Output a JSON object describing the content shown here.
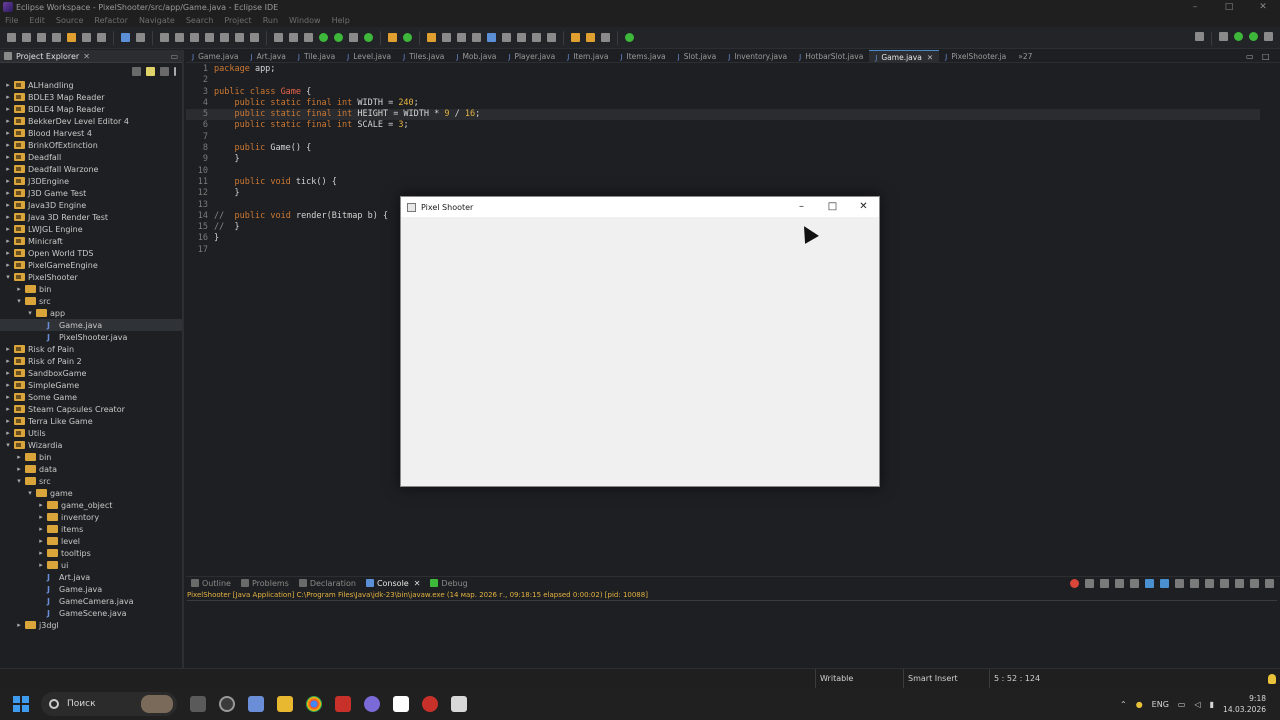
{
  "window": {
    "title": "Eclipse Workspace - PixelShooter/src/app/Game.java - Eclipse IDE",
    "controls": [
      "–",
      "□",
      "✕"
    ]
  },
  "menu": [
    "File",
    "Edit",
    "Source",
    "Refactor",
    "Navigate",
    "Search",
    "Project",
    "Run",
    "Window",
    "Help"
  ],
  "project_explorer": {
    "title": "Project Explorer",
    "tree": [
      {
        "label": "ALHandling",
        "level": 0,
        "type": "project",
        "expanded": false
      },
      {
        "label": "BDLE3 Map Reader",
        "level": 0,
        "type": "project",
        "expanded": false
      },
      {
        "label": "BDLE4 Map Reader",
        "level": 0,
        "type": "project",
        "expanded": false
      },
      {
        "label": "BekkerDev Level Editor 4",
        "level": 0,
        "type": "project",
        "expanded": false
      },
      {
        "label": "Blood Harvest 4",
        "level": 0,
        "type": "project",
        "expanded": false
      },
      {
        "label": "BrinkOfExtinction",
        "level": 0,
        "type": "project",
        "expanded": false
      },
      {
        "label": "Deadfall",
        "level": 0,
        "type": "project",
        "expanded": false
      },
      {
        "label": "Deadfall Warzone",
        "level": 0,
        "type": "project",
        "expanded": false
      },
      {
        "label": "J3DEngine",
        "level": 0,
        "type": "project",
        "expanded": false
      },
      {
        "label": "J3D Game Test",
        "level": 0,
        "type": "project",
        "expanded": false
      },
      {
        "label": "Java3D Engine",
        "level": 0,
        "type": "project",
        "expanded": false
      },
      {
        "label": "Java 3D Render Test",
        "level": 0,
        "type": "project",
        "expanded": false
      },
      {
        "label": "LWJGL Engine",
        "level": 0,
        "type": "project",
        "expanded": false
      },
      {
        "label": "Minicraft",
        "level": 0,
        "type": "project",
        "expanded": false
      },
      {
        "label": "Open World TDS",
        "level": 0,
        "type": "project",
        "expanded": false
      },
      {
        "label": "PixelGameEngine",
        "level": 0,
        "type": "project",
        "expanded": false
      },
      {
        "label": "PixelShooter",
        "level": 0,
        "type": "project",
        "expanded": true
      },
      {
        "label": "bin",
        "level": 1,
        "type": "folder",
        "expanded": false
      },
      {
        "label": "src",
        "level": 1,
        "type": "folder",
        "expanded": true
      },
      {
        "label": "app",
        "level": 2,
        "type": "folder",
        "expanded": true
      },
      {
        "label": "Game.java",
        "level": 3,
        "type": "file",
        "selected": true
      },
      {
        "label": "PixelShooter.java",
        "level": 3,
        "type": "file"
      },
      {
        "label": "Risk of Pain",
        "level": 0,
        "type": "project",
        "expanded": false
      },
      {
        "label": "Risk of Pain 2",
        "level": 0,
        "type": "project",
        "expanded": false
      },
      {
        "label": "SandboxGame",
        "level": 0,
        "type": "project",
        "expanded": false
      },
      {
        "label": "SimpleGame",
        "level": 0,
        "type": "project",
        "expanded": false
      },
      {
        "label": "Some Game",
        "level": 0,
        "type": "project",
        "expanded": false
      },
      {
        "label": "Steam Capsules Creator",
        "level": 0,
        "type": "project",
        "expanded": false
      },
      {
        "label": "Terra Like Game",
        "level": 0,
        "type": "project",
        "expanded": false
      },
      {
        "label": "Utils",
        "level": 0,
        "type": "project",
        "expanded": false
      },
      {
        "label": "Wizardia",
        "level": 0,
        "type": "project",
        "expanded": true
      },
      {
        "label": "bin",
        "level": 1,
        "type": "folder",
        "expanded": false
      },
      {
        "label": "data",
        "level": 1,
        "type": "folder",
        "expanded": false
      },
      {
        "label": "src",
        "level": 1,
        "type": "folder",
        "expanded": true
      },
      {
        "label": "game",
        "level": 2,
        "type": "folder",
        "expanded": true
      },
      {
        "label": "game_object",
        "level": 3,
        "type": "folder",
        "expanded": false
      },
      {
        "label": "inventory",
        "level": 3,
        "type": "folder",
        "expanded": false
      },
      {
        "label": "items",
        "level": 3,
        "type": "folder",
        "expanded": false
      },
      {
        "label": "level",
        "level": 3,
        "type": "folder",
        "expanded": false
      },
      {
        "label": "tooltips",
        "level": 3,
        "type": "folder",
        "expanded": false
      },
      {
        "label": "ui",
        "level": 3,
        "type": "folder",
        "expanded": false
      },
      {
        "label": "Art.java",
        "level": 3,
        "type": "file"
      },
      {
        "label": "Game.java",
        "level": 3,
        "type": "file"
      },
      {
        "label": "GameCamera.java",
        "level": 3,
        "type": "file"
      },
      {
        "label": "GameScene.java",
        "level": 3,
        "type": "file"
      },
      {
        "label": "j3dgl",
        "level": 1,
        "type": "folder",
        "expanded": false
      }
    ]
  },
  "editor_tabs": [
    {
      "label": "Game.java",
      "active": false
    },
    {
      "label": "Art.java",
      "active": false
    },
    {
      "label": "Tile.java",
      "active": false
    },
    {
      "label": "Level.java",
      "active": false
    },
    {
      "label": "Tiles.java",
      "active": false
    },
    {
      "label": "Mob.java",
      "active": false
    },
    {
      "label": "Player.java",
      "active": false
    },
    {
      "label": "Item.java",
      "active": false
    },
    {
      "label": "Items.java",
      "active": false
    },
    {
      "label": "Slot.java",
      "active": false
    },
    {
      "label": "Inventory.java",
      "active": false
    },
    {
      "label": "HotbarSlot.java",
      "active": false
    },
    {
      "label": "Game.java",
      "active": true
    },
    {
      "label": "PixelShooter.ja",
      "active": false
    },
    {
      "label": "»27",
      "active": false
    }
  ],
  "code": [
    {
      "n": "1",
      "text": "package app;"
    },
    {
      "n": "2",
      "text": ""
    },
    {
      "n": "3",
      "text": "public class Game {"
    },
    {
      "n": "4",
      "text": "    public static final int WIDTH = 240;"
    },
    {
      "n": "5",
      "text": "    public static final int HEIGHT = WIDTH * 9 / 16;",
      "highlight": true
    },
    {
      "n": "6",
      "text": "    public static final int SCALE = 3;"
    },
    {
      "n": "7",
      "text": ""
    },
    {
      "n": "8",
      "text": "    public Game() {"
    },
    {
      "n": "9",
      "text": "    }"
    },
    {
      "n": "10",
      "text": ""
    },
    {
      "n": "11",
      "text": "    public void tick() {"
    },
    {
      "n": "12",
      "text": "    }"
    },
    {
      "n": "13",
      "text": ""
    },
    {
      "n": "14",
      "text": "//  public void render(Bitmap b) {"
    },
    {
      "n": "15",
      "text": "//  }"
    },
    {
      "n": "16",
      "text": "}"
    },
    {
      "n": "17",
      "text": ""
    }
  ],
  "bottom_tabs": [
    {
      "label": "Outline",
      "active": false
    },
    {
      "label": "Problems",
      "active": false
    },
    {
      "label": "Declaration",
      "active": false
    },
    {
      "label": "Console",
      "active": true
    },
    {
      "label": "Debug",
      "active": false
    }
  ],
  "console_status": "PixelShooter [Java Application] C:\\Program Files\\Java\\jdk-23\\bin\\javaw.exe  (14 мар. 2026 г., 09:18:15 elapsed 0:00:02) [pid: 10088]",
  "statusbar": {
    "writable": "Writable",
    "insert_mode": "Smart Insert",
    "position": "5 : 52 : 124"
  },
  "app_window": {
    "title": "Pixel Shooter",
    "controls": [
      "–",
      "□",
      "✕"
    ]
  },
  "taskbar": {
    "search_placeholder": "Поиск",
    "lang": "ENG",
    "time": "9:18",
    "date": "14.03.2026"
  }
}
